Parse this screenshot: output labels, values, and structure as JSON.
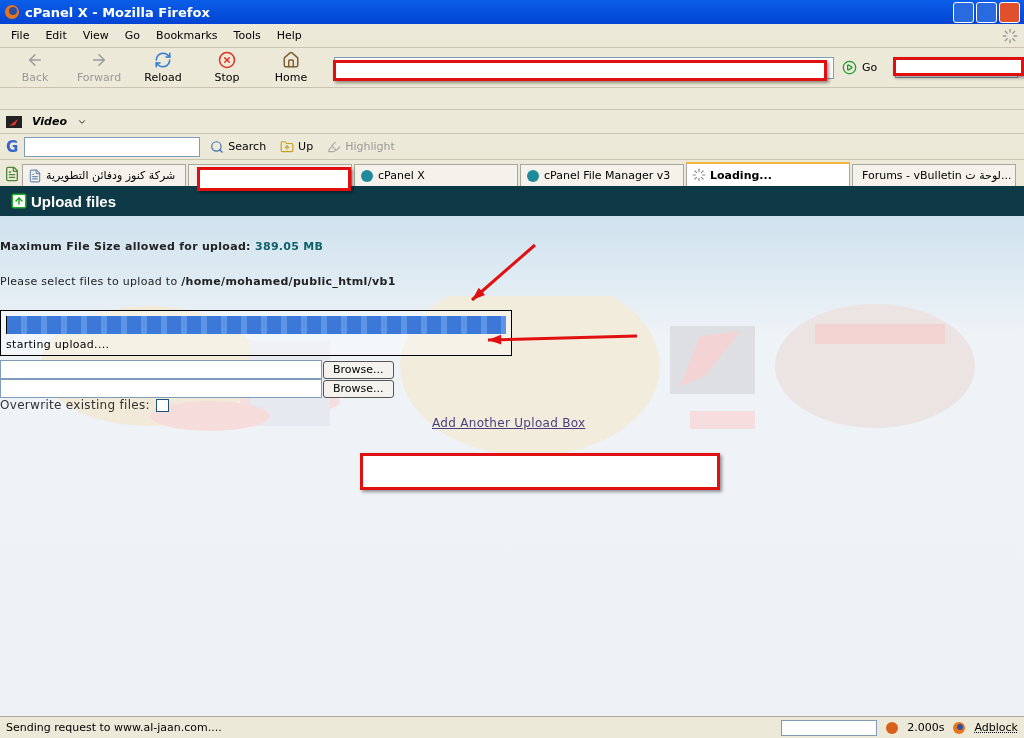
{
  "window": {
    "title": "cPanel X - Mozilla Firefox"
  },
  "menu": [
    "File",
    "Edit",
    "View",
    "Go",
    "Bookmarks",
    "Tools",
    "Help"
  ],
  "nav_buttons": [
    {
      "label": "Back",
      "kind": "back",
      "disabled": true
    },
    {
      "label": "Forward",
      "kind": "forward",
      "disabled": true
    },
    {
      "label": "Reload",
      "kind": "reload",
      "disabled": false
    },
    {
      "label": "Stop",
      "kind": "stop",
      "disabled": false
    },
    {
      "label": "Home",
      "kind": "home",
      "disabled": false
    }
  ],
  "go_button": "Go",
  "video_toolbar": {
    "label": "Video"
  },
  "google_toolbar": {
    "logo": "G",
    "search": "Search",
    "up": "Up",
    "highlight": "Highlight"
  },
  "tabs": [
    {
      "title": "شركة كنوز ودفائن التطويرية",
      "selected": false
    },
    {
      "selected": false
    },
    {
      "title": "cPanel X",
      "selected": false
    },
    {
      "title": "cPanel File Manager v3",
      "selected": false
    },
    {
      "title": "Loading...",
      "selected": true
    },
    {
      "title": "Forums - vBulletin لوحة ت...",
      "selected": false
    }
  ],
  "page": {
    "heading": "Upload files",
    "max_size_label": "Maximum File Size allowed for upload:",
    "max_size": "389.05 MB",
    "select_text": "Please select files to upload to",
    "path": "/home/mohamed/public_html/vb1",
    "progress": {
      "level": 1,
      "status": "starting upload...."
    },
    "file_rows": [
      {
        "button": "Browse..."
      },
      {
        "button": "Browse..."
      }
    ],
    "overwrite": {
      "label": "Overwrite existing files:",
      "checked": false
    },
    "add_link": "Add Another Upload Box"
  },
  "annotations": [
    {
      "kind": "redaction"
    },
    {
      "kind": "redaction"
    },
    {
      "kind": "redaction"
    },
    {
      "kind": "redaction"
    },
    {
      "kind": "arrow"
    },
    {
      "kind": "arrow"
    }
  ],
  "status_bar": {
    "text": "Sending request to www.al-jaan.com....",
    "timer": "2.000s",
    "adblock": "Adblock"
  }
}
